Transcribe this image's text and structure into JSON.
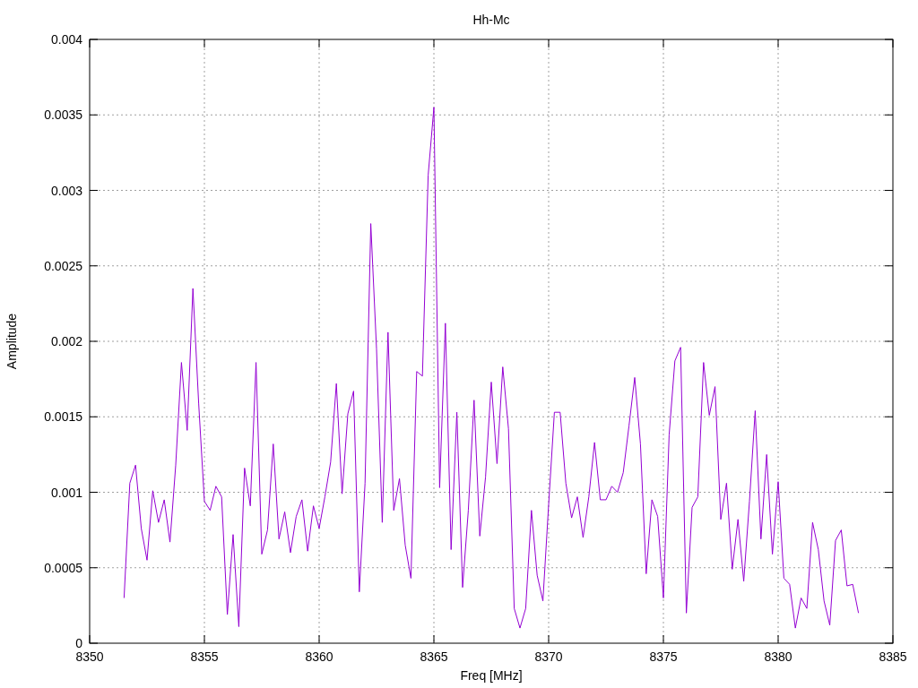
{
  "chart_data": {
    "type": "line",
    "grid": true,
    "title": "Hh-Mc",
    "xlabel": "Freq [MHz]",
    "ylabel": "Amplitude",
    "xlim": [
      8350,
      8385
    ],
    "ylim": [
      0,
      0.004
    ],
    "xticks": [
      8350,
      8355,
      8360,
      8365,
      8370,
      8375,
      8380,
      8385
    ],
    "yticks": [
      {
        "value": 0,
        "label": "0"
      },
      {
        "value": 0.0005,
        "label": "0.0005"
      },
      {
        "value": 0.001,
        "label": "0.001"
      },
      {
        "value": 0.0015,
        "label": "0.0015"
      },
      {
        "value": 0.002,
        "label": "0.002"
      },
      {
        "value": 0.0025,
        "label": "0.0025"
      },
      {
        "value": 0.003,
        "label": "0.003"
      },
      {
        "value": 0.0035,
        "label": "0.0035"
      },
      {
        "value": 0.004,
        "label": "0.004"
      }
    ],
    "x": [
      8351.5,
      8351.75,
      8352,
      8352.25,
      8352.5,
      8352.75,
      8353,
      8353.25,
      8353.5,
      8353.75,
      8354,
      8354.25,
      8354.5,
      8354.75,
      8355,
      8355.25,
      8355.5,
      8355.75,
      8356,
      8356.25,
      8356.5,
      8356.75,
      8357,
      8357.25,
      8357.5,
      8357.75,
      8358,
      8358.25,
      8358.5,
      8358.75,
      8359,
      8359.25,
      8359.5,
      8359.75,
      8360,
      8360.25,
      8360.5,
      8360.75,
      8361,
      8361.25,
      8361.5,
      8361.75,
      8362,
      8362.25,
      8362.5,
      8362.75,
      8363,
      8363.25,
      8363.5,
      8363.75,
      8364,
      8364.25,
      8364.5,
      8364.75,
      8365,
      8365.25,
      8365.5,
      8365.75,
      8366,
      8366.25,
      8366.5,
      8366.75,
      8367,
      8367.25,
      8367.5,
      8367.75,
      8368,
      8368.25,
      8368.5,
      8368.75,
      8369,
      8369.25,
      8369.5,
      8369.75,
      8370,
      8370.25,
      8370.5,
      8370.75,
      8371,
      8371.25,
      8371.5,
      8371.75,
      8372,
      8372.25,
      8372.5,
      8372.75,
      8373,
      8373.25,
      8373.5,
      8373.75,
      8374,
      8374.25,
      8374.5,
      8374.75,
      8375,
      8375.25,
      8375.5,
      8375.75,
      8376,
      8376.25,
      8376.5,
      8376.75,
      8377,
      8377.25,
      8377.5,
      8377.75,
      8378,
      8378.25,
      8378.5,
      8378.75,
      8379,
      8379.25,
      8379.5,
      8379.75,
      8380,
      8380.25,
      8380.5,
      8380.75,
      8381,
      8381.25,
      8381.5,
      8381.75,
      8382,
      8382.25,
      8382.5,
      8382.75,
      8383,
      8383.25,
      8383.5
    ],
    "series": [
      {
        "color": "#9400d3",
        "values": [
          0.0003,
          0.00106,
          0.00118,
          0.00076,
          0.00055,
          0.00101,
          0.0008,
          0.00095,
          0.00067,
          0.00118,
          0.00186,
          0.00141,
          0.00235,
          0.00159,
          0.00094,
          0.00088,
          0.00104,
          0.00097,
          0.00019,
          0.00072,
          0.00011,
          0.00116,
          0.00091,
          0.00186,
          0.00059,
          0.00075,
          0.00132,
          0.00069,
          0.00087,
          0.0006,
          0.00084,
          0.00095,
          0.00061,
          0.00091,
          0.00076,
          0.00097,
          0.0012,
          0.00172,
          0.00099,
          0.00152,
          0.00167,
          0.00034,
          0.00106,
          0.00278,
          0.00195,
          0.0008,
          0.00206,
          0.00088,
          0.00109,
          0.00065,
          0.00043,
          0.0018,
          0.00177,
          0.0031,
          0.00355,
          0.00103,
          0.00212,
          0.00062,
          0.00153,
          0.00037,
          0.00088,
          0.00161,
          0.00071,
          0.0011,
          0.00173,
          0.00119,
          0.00183,
          0.00142,
          0.00023,
          0.0001,
          0.00023,
          0.00088,
          0.00045,
          0.00028,
          0.00092,
          0.00153,
          0.00153,
          0.00106,
          0.00083,
          0.00097,
          0.0007,
          0.00097,
          0.00133,
          0.00095,
          0.00095,
          0.00104,
          0.001,
          0.00113,
          0.00144,
          0.00176,
          0.00132,
          0.00046,
          0.00095,
          0.00084,
          0.0003,
          0.00138,
          0.00187,
          0.00196,
          0.0002,
          0.0009,
          0.00097,
          0.00186,
          0.00151,
          0.0017,
          0.00082,
          0.00106,
          0.00049,
          0.00082,
          0.00041,
          0.00094,
          0.00154,
          0.00069,
          0.00125,
          0.00059,
          0.00107,
          0.00043,
          0.00039,
          0.0001,
          0.0003,
          0.00023,
          0.0008,
          0.00062,
          0.00028,
          0.00012,
          0.00068,
          0.00075,
          0.00038,
          0.00039,
          0.0002
        ]
      }
    ]
  }
}
